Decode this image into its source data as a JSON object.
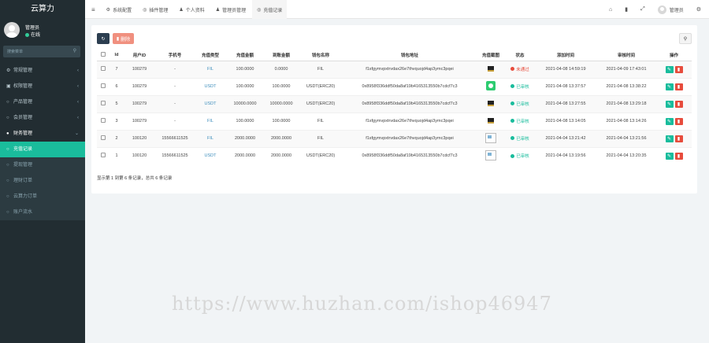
{
  "sidebar": {
    "logo": "云算力",
    "user": {
      "name": "管理员",
      "status": "在线"
    },
    "search_placeholder": "搜索菜单",
    "menu": [
      {
        "label": "常规管理",
        "icon": "gear-icon",
        "has_children": true
      },
      {
        "label": "权限管理",
        "icon": "group-icon",
        "has_children": true
      },
      {
        "label": "产品管理",
        "icon": "circle-icon",
        "has_children": true
      },
      {
        "label": "会员管理",
        "icon": "circle-icon",
        "has_children": true
      },
      {
        "label": "财务管理",
        "icon": "circle-icon",
        "has_children": true,
        "open": true
      }
    ],
    "submenu": [
      {
        "label": "充值记录",
        "active": true
      },
      {
        "label": "提现管理"
      },
      {
        "label": "理财订单"
      },
      {
        "label": "云算力订单"
      },
      {
        "label": "账户流水"
      }
    ]
  },
  "topbar": {
    "tabs": [
      {
        "label": "系统配置",
        "icon": "gear-icon"
      },
      {
        "label": "插件管理",
        "icon": "circle-icon"
      },
      {
        "label": "个人资料",
        "icon": "user-icon"
      },
      {
        "label": "管理员管理",
        "icon": "user-icon"
      },
      {
        "label": "充值记录",
        "icon": "circle-icon",
        "active": true
      }
    ],
    "user_name": "管理员"
  },
  "toolbar": {
    "delete_label": "删除"
  },
  "table": {
    "headers": [
      "Id",
      "用户ID",
      "手机号",
      "充值类型",
      "充值金额",
      "到账金额",
      "钱包名称",
      "钱包地址",
      "充值截图",
      "状态",
      "添加时间",
      "审核时间",
      "操作"
    ],
    "rows": [
      {
        "id": "7",
        "uid": "100279",
        "phone": "-",
        "type": "FIL",
        "amount": "100.0000",
        "received": "0.0000",
        "wallet": "FIL",
        "address": "f1sfgymvpxtrvdax26e7thvquojd4ap3ymc3pqei",
        "shot": "t-black",
        "status": "未通过",
        "status_kind": "rej",
        "added": "2021-04-08 14:59:19",
        "reviewed": "2021-04-09 17:43:01"
      },
      {
        "id": "6",
        "uid": "100279",
        "phone": "-",
        "type": "USDT",
        "amount": "100.0000",
        "received": "100.0000",
        "wallet": "USDT(ERC20)",
        "address": "0x8958f336ddf50da8af19b4165313550b7cdcf7c3",
        "shot": "t-green",
        "status": "已审核",
        "status_kind": "ok",
        "added": "2021-04-08 13:37:57",
        "reviewed": "2021-04-08 13:38:22"
      },
      {
        "id": "5",
        "uid": "100279",
        "phone": "-",
        "type": "USDT",
        "amount": "10000.0000",
        "received": "10000.0000",
        "wallet": "USDT(ERC20)",
        "address": "0x8958f336ddf50da8af19b4165313550b7cdcf7c3",
        "shot": "t-black",
        "status": "已审核",
        "status_kind": "ok",
        "added": "2021-04-08 13:27:55",
        "reviewed": "2021-04-08 13:29:18"
      },
      {
        "id": "3",
        "uid": "100279",
        "phone": "-",
        "type": "FIL",
        "amount": "100.0000",
        "received": "100.0000",
        "wallet": "FIL",
        "address": "f1sfgymvpxtrvdax26e7thvquojd4ap3ymc3pqei",
        "shot": "t-black",
        "status": "已审核",
        "status_kind": "ok",
        "added": "2021-04-08 13:14:05",
        "reviewed": "2021-04-08 13:14:26"
      },
      {
        "id": "2",
        "uid": "100120",
        "phone": "15566611525",
        "type": "FIL",
        "amount": "2000.0000",
        "received": "2000.0000",
        "wallet": "FIL",
        "address": "f1sfgymvpxtrvdax26e7thvquojd4ap3ymc3pqei",
        "shot": "t-broken",
        "status": "已审核",
        "status_kind": "ok",
        "added": "2021-04-04 13:21:42",
        "reviewed": "2021-04-04 13:21:56"
      },
      {
        "id": "1",
        "uid": "100120",
        "phone": "15566611525",
        "type": "USDT",
        "amount": "2000.0000",
        "received": "2000.0000",
        "wallet": "USDT(ERC20)",
        "address": "0x8958f336ddf50da8af19b4165313550b7cdcf7c3",
        "shot": "t-broken",
        "status": "已审核",
        "status_kind": "ok",
        "added": "2021-04-04 13:19:56",
        "reviewed": "2021-04-04 13:20:35"
      }
    ]
  },
  "pager_text": "显示第 1 到第 6 条记录，总共 6 条记录",
  "watermark": "https://www.huzhan.com/ishop46947",
  "colors": {
    "sidebar_bg": "#222d32",
    "active": "#1abc9c",
    "link": "#3c8dbc",
    "danger": "#e74c3c"
  }
}
